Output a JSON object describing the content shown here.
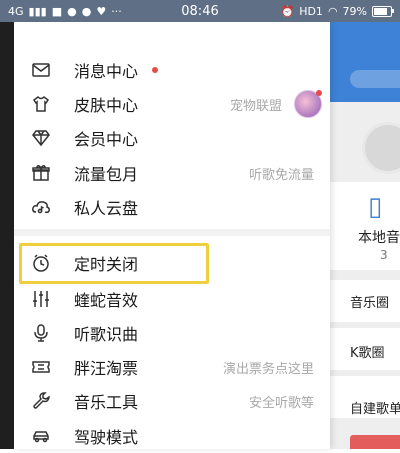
{
  "status_bar": {
    "network": "4G",
    "time": "08:46",
    "hd": "HD1",
    "battery": "79%",
    "battery_level": 0.79
  },
  "menu": {
    "items": [
      {
        "label": "消息中心",
        "sub": "",
        "icon": "mail-icon",
        "badge": true
      },
      {
        "label": "皮肤中心",
        "sub": "宠物联盟",
        "icon": "tshirt-icon",
        "badge": false
      },
      {
        "label": "会员中心",
        "sub": "",
        "icon": "diamond-icon",
        "badge": false
      },
      {
        "label": "流量包月",
        "sub": "听歌免流量",
        "icon": "gift-icon",
        "badge": false
      },
      {
        "label": "私人云盘",
        "sub": "",
        "icon": "cloud-music-icon",
        "badge": false
      },
      {
        "label": "定时关闭",
        "sub": "",
        "icon": "timer-icon",
        "badge": false
      },
      {
        "label": "蝰蛇音效",
        "sub": "",
        "icon": "equalizer-icon",
        "badge": false
      },
      {
        "label": "听歌识曲",
        "sub": "",
        "icon": "microphone-icon",
        "badge": false
      },
      {
        "label": "胖汪淘票",
        "sub": "演出票务点这里",
        "icon": "ticket-icon",
        "badge": false
      },
      {
        "label": "音乐工具",
        "sub": "安全听歌等",
        "icon": "wrench-icon",
        "badge": false
      },
      {
        "label": "驾驶模式",
        "sub": "",
        "icon": "car-icon",
        "badge": false
      }
    ]
  },
  "background": {
    "local_label": "本地音",
    "local_count": "3",
    "rows": [
      "音乐圈",
      "K歌圈",
      "自建歌单"
    ]
  },
  "colors": {
    "highlight": "#f0cf3c",
    "accent_blue": "#3d82d6",
    "badge_red": "#e84a4a"
  }
}
